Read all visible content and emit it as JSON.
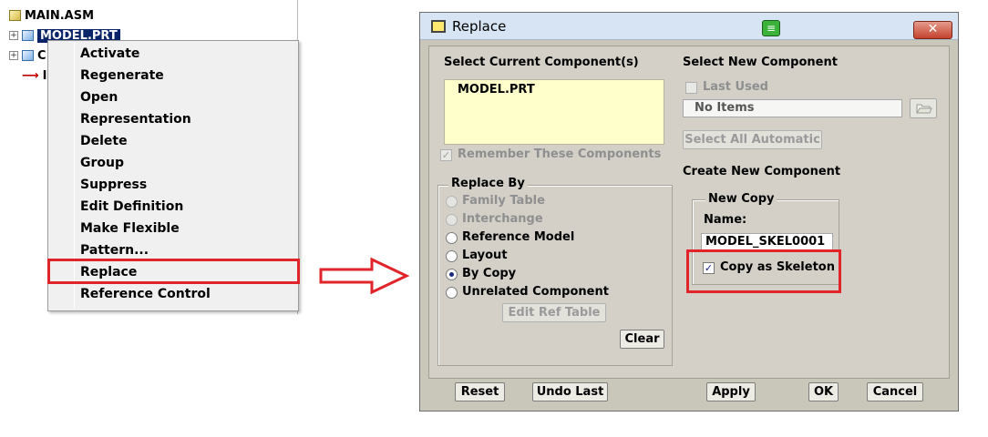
{
  "tree": {
    "root_label": "MAIN.ASM",
    "items": [
      "MODEL.PRT",
      "C",
      "I"
    ]
  },
  "context_menu": {
    "items": [
      "Activate",
      "Regenerate",
      "Open",
      "Representation",
      "Delete",
      "Group",
      "Suppress",
      "Edit Definition",
      "Make Flexible",
      "Pattern...",
      "Replace",
      "Reference Control"
    ]
  },
  "dialog": {
    "title": "Replace",
    "close_glyph": "✕",
    "current": {
      "header": "Select Current Component(s)",
      "items": [
        "MODEL.PRT"
      ],
      "remember_label": "Remember These Components",
      "remember_checked": true
    },
    "replace_by": {
      "legend": "Replace By",
      "options": [
        {
          "label": "Family Table",
          "enabled": false,
          "selected": false
        },
        {
          "label": "Interchange",
          "enabled": false,
          "selected": false
        },
        {
          "label": "Reference Model",
          "enabled": true,
          "selected": false
        },
        {
          "label": "Layout",
          "enabled": true,
          "selected": false
        },
        {
          "label": "By Copy",
          "enabled": true,
          "selected": true
        },
        {
          "label": "Unrelated Component",
          "enabled": true,
          "selected": false
        }
      ],
      "edit_ref_table": "Edit Ref Table",
      "clear": "Clear"
    },
    "new_component": {
      "header": "Select New Component",
      "last_used_label": "Last Used",
      "items_value": "No Items",
      "select_all_automatic": "Select All Automatic"
    },
    "create": {
      "header": "Create New Component",
      "legend": "New Copy",
      "name_label": "Name:",
      "name_value": "MODEL_SKEL0001",
      "copy_as_skeleton_label": "Copy as Skeleton",
      "copy_as_skeleton_checked": true
    },
    "buttons": {
      "reset": "Reset",
      "undo_last": "Undo Last",
      "apply": "Apply",
      "ok": "OK",
      "cancel": "Cancel"
    }
  },
  "colors": {
    "highlight": "#e0242a",
    "selection": "#0a246a",
    "list_bg": "#ffffcc"
  }
}
